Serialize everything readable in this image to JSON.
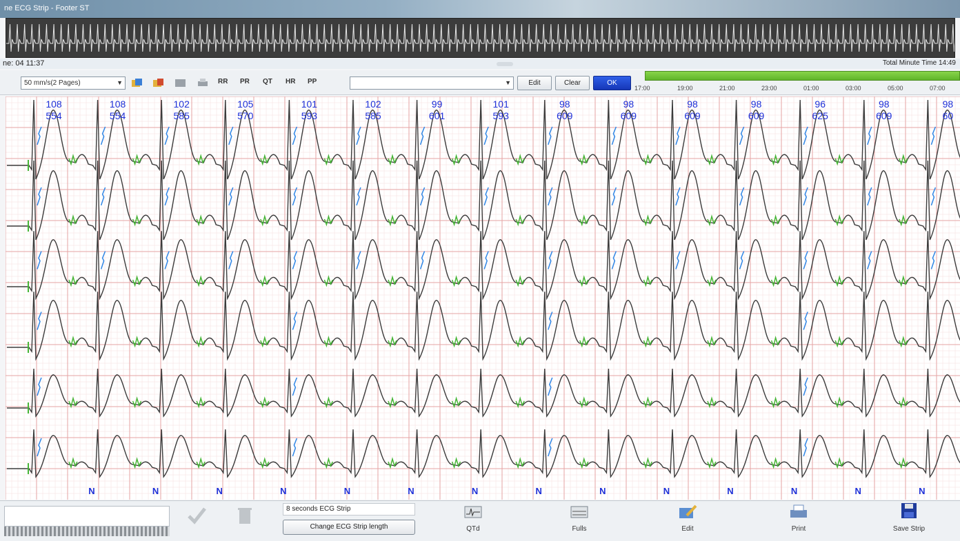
{
  "window": {
    "title": "ne ECG Strip - Footer ST"
  },
  "status": {
    "time_readout": "ne: 04 11:37",
    "total_minute": "Total Minute Time 14:49"
  },
  "toolbar": {
    "speed_select": "50 mm/s(2 Pages)",
    "measure_labels": [
      "RR",
      "PR",
      "QT",
      "HR",
      "PP"
    ],
    "edit_label": "Edit",
    "clear_label": "Clear",
    "ok_label": "OK"
  },
  "timeline": {
    "ticks": [
      "17:00",
      "19:00",
      "21:00",
      "23:00",
      "01:00",
      "03:00",
      "05:00",
      "07:00"
    ]
  },
  "ecg": {
    "beats": [
      {
        "hr": "108",
        "rr": "554"
      },
      {
        "hr": "108",
        "rr": "554"
      },
      {
        "hr": "102",
        "rr": "585"
      },
      {
        "hr": "105",
        "rr": "570"
      },
      {
        "hr": "101",
        "rr": "593"
      },
      {
        "hr": "102",
        "rr": "585"
      },
      {
        "hr": "99",
        "rr": "601"
      },
      {
        "hr": "101",
        "rr": "593"
      },
      {
        "hr": "98",
        "rr": "609"
      },
      {
        "hr": "98",
        "rr": "609"
      },
      {
        "hr": "98",
        "rr": "609"
      },
      {
        "hr": "98",
        "rr": "609"
      },
      {
        "hr": "96",
        "rr": "625"
      },
      {
        "hr": "98",
        "rr": "609"
      },
      {
        "hr": "98",
        "rr": "60"
      }
    ],
    "beat_class": "N",
    "lead_count": 6,
    "colors": {
      "trace": "#3b3b3b",
      "p_marker": "#46b536",
      "q_marker": "#2f86e6",
      "label": "#1d2fd8",
      "grid_major": "#e6a3a3",
      "grid_minor": "#f6dede"
    }
  },
  "bottom": {
    "strip_info": "8 seconds ECG Strip",
    "change_label": "Change ECG Strip length",
    "actions": [
      {
        "label": "QTd",
        "icon": "qtd-icon"
      },
      {
        "label": "Fulls",
        "icon": "fulls-icon"
      },
      {
        "label": "Edit",
        "icon": "edit-icon"
      },
      {
        "label": "Print",
        "icon": "print-icon"
      },
      {
        "label": "Save Strip",
        "icon": "save-icon"
      }
    ]
  }
}
